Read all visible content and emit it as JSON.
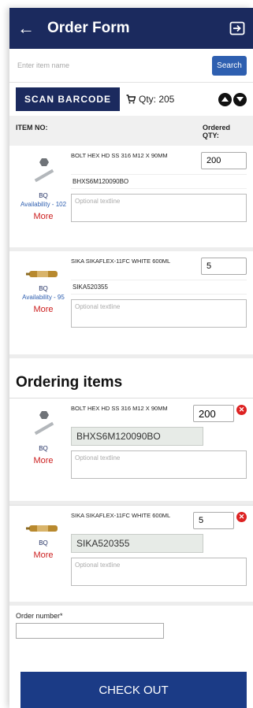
{
  "header": {
    "title": "Order Form",
    "back_icon": "back-arrow-icon",
    "logout_icon": "logout-icon"
  },
  "search": {
    "placeholder": "Enter item name",
    "button": "Search"
  },
  "scan": {
    "button": "SCAN BARCODE",
    "qty_label": "Qty: 205"
  },
  "columns": {
    "item_no": "ITEM NO:",
    "ordered_qty": "Ordered QTY:"
  },
  "items": [
    {
      "description": "BOLT HEX HD SS 316 M12 X 90MM",
      "qty": "200",
      "code": "BHXS6M120090BO",
      "bq": "BQ",
      "availability": "Availability - 102",
      "more": "More",
      "note_placeholder": "Optional textline",
      "icon": "bolt-icon"
    },
    {
      "description": "SIKA SIKAFLEX-11FC WHITE 600ML",
      "qty": "5",
      "code": "SIKA520355",
      "bq": "BQ",
      "availability": "Availability - 95",
      "more": "More",
      "note_placeholder": "Optional textline",
      "icon": "sealant-tube-icon"
    }
  ],
  "ordering": {
    "title": "Ordering items",
    "items": [
      {
        "description": "BOLT HEX HD SS 316 M12 X 90MM",
        "qty": "200",
        "code": "BHXS6M120090BO",
        "bq": "BQ",
        "more": "More",
        "note_placeholder": "Optional textline",
        "remove_icon": "remove-x-icon"
      },
      {
        "description": "SIKA SIKAFLEX-11FC WHITE 600ML",
        "qty": "5",
        "code": "SIKA520355",
        "bq": "BQ",
        "more": "More",
        "note_placeholder": "Optional textline",
        "remove_icon": "remove-x-icon"
      }
    ]
  },
  "order_number": {
    "label": "Order number*"
  },
  "checkout": {
    "label": "CHECK OUT"
  },
  "colors": {
    "primary": "#1b2a5e",
    "search_button": "#2e5fb0",
    "link_red": "#cc1f1f",
    "checkout": "#1b3b86"
  }
}
